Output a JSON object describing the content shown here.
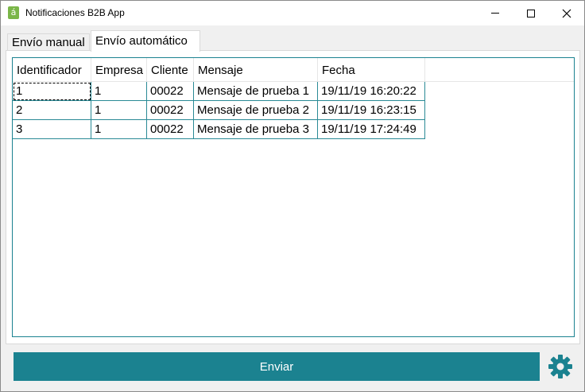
{
  "window": {
    "title": "Notificaciones B2B App",
    "app_icon_glyph": "á",
    "app_icon_color": "#7ab648"
  },
  "tabs": [
    {
      "label": "Envío manual",
      "selected": false
    },
    {
      "label": "Envío automático",
      "selected": true
    }
  ],
  "table": {
    "columns": [
      "Identificador",
      "Empresa",
      "Cliente",
      "Mensaje",
      "Fecha"
    ],
    "rows": [
      [
        "1",
        "1",
        "00022",
        "Mensaje de prueba 1",
        "19/11/19 16:20:22"
      ],
      [
        "2",
        "1",
        "00022",
        "Mensaje de prueba 2",
        "19/11/19 16:23:15"
      ],
      [
        "3",
        "1",
        "00022",
        "Mensaje de prueba 3",
        "19/11/19 17:24:49"
      ]
    ]
  },
  "actions": {
    "send_label": "Enviar",
    "settings_icon": "gear-icon"
  },
  "colors": {
    "accent": "#1b8290",
    "border": "#1b8290"
  }
}
